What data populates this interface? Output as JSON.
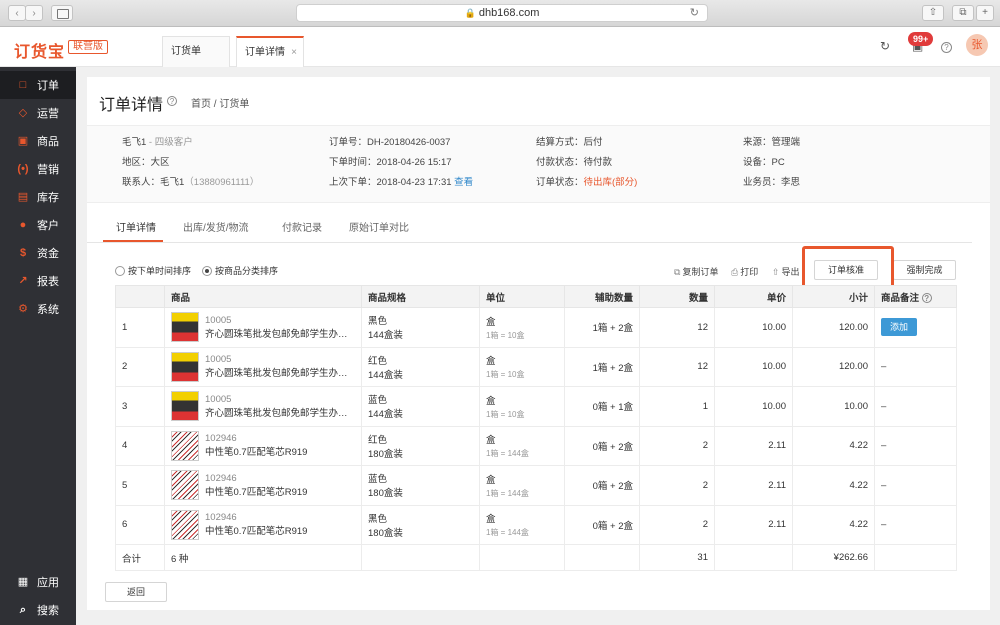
{
  "browser": {
    "url": "dhb168.com"
  },
  "app": {
    "logo": "订货宝",
    "edition": "联营版",
    "tabs": [
      {
        "label": "订货单",
        "close": ""
      },
      {
        "label": "订单详情",
        "close": "×"
      }
    ],
    "notif_badge": "99+",
    "help_icon": "?",
    "avatar_text": "张"
  },
  "sidebar": {
    "items": [
      {
        "label": "订单",
        "icon": "order-icon",
        "glyph": "□"
      },
      {
        "label": "运营",
        "icon": "operation-icon",
        "glyph": "◇"
      },
      {
        "label": "商品",
        "icon": "goods-icon",
        "glyph": "▣"
      },
      {
        "label": "营销",
        "icon": "marketing-icon",
        "glyph": "(•)"
      },
      {
        "label": "库存",
        "icon": "stock-icon",
        "glyph": "▤"
      },
      {
        "label": "客户",
        "icon": "customer-icon",
        "glyph": "●"
      },
      {
        "label": "资金",
        "icon": "fund-icon",
        "glyph": "$"
      },
      {
        "label": "报表",
        "icon": "report-icon",
        "glyph": "↗"
      },
      {
        "label": "系统",
        "icon": "system-icon",
        "glyph": "⚙"
      }
    ],
    "bottom": [
      {
        "label": "应用",
        "icon": "apps-icon",
        "glyph": "▦"
      },
      {
        "label": "搜索",
        "icon": "search-icon",
        "glyph": "⌕"
      }
    ]
  },
  "page": {
    "title": "订单详情",
    "breadcrumb": "首页 / 订货单",
    "info": {
      "customer": "毛飞1",
      "customer_level": " - 四级客户",
      "region": "地区：大区",
      "contact": "联系人：毛飞1",
      "contact_phone": "（13880961111）",
      "order_no": "订单号：DH-20180426-0037",
      "order_time": "下单时间：2018-04-26 15:17",
      "last_order": "上次下单：2018-04-23 17:31",
      "view_link": "查看",
      "settle": "结算方式：后付",
      "pay_status": "付款状态：待付款",
      "order_status_label": "订单状态：",
      "order_status_value": "待出库(部分)",
      "source": "来源：管理端",
      "device": "设备：PC",
      "salesman": "业务员：李思"
    },
    "tabs": [
      "订单详情",
      "出库/发货/物流",
      "付款记录",
      "原始订单对比"
    ],
    "sort_options": [
      "按下单时间排序",
      "按商品分类排序"
    ],
    "tools": {
      "copy": "复制订单",
      "print": "打印",
      "export": "导出"
    },
    "buttons": {
      "approve": "订单核准",
      "force_complete": "强制完成",
      "back": "返回"
    }
  },
  "table": {
    "headers": [
      "商品",
      "商品规格",
      "单位",
      "辅助数量",
      "数量",
      "单价",
      "小计",
      "商品备注"
    ],
    "rows": [
      {
        "idx": "1",
        "code": "10005",
        "name": "齐心圆珠笔批发包邮免邮学生办公…",
        "spec_color": "黑色",
        "spec_pack": "144盒装",
        "unit": "盒",
        "unit_conv": "1箱 = 10盒",
        "aux": "1箱 + 2盒",
        "qty": "12",
        "price": "10.00",
        "subtotal": "120.00",
        "remark": "添加",
        "thumb": "t1"
      },
      {
        "idx": "2",
        "code": "10005",
        "name": "齐心圆珠笔批发包邮免邮学生办公…",
        "spec_color": "红色",
        "spec_pack": "144盒装",
        "unit": "盒",
        "unit_conv": "1箱 = 10盒",
        "aux": "1箱 + 2盒",
        "qty": "12",
        "price": "10.00",
        "subtotal": "120.00",
        "remark": "–",
        "thumb": "t1"
      },
      {
        "idx": "3",
        "code": "10005",
        "name": "齐心圆珠笔批发包邮免邮学生办公…",
        "spec_color": "蓝色",
        "spec_pack": "144盒装",
        "unit": "盒",
        "unit_conv": "1箱 = 10盒",
        "aux": "0箱 + 1盒",
        "qty": "1",
        "price": "10.00",
        "subtotal": "10.00",
        "remark": "–",
        "thumb": "t1"
      },
      {
        "idx": "4",
        "code": "102946",
        "name": "中性笔0.7匹配笔芯R919",
        "spec_color": "红色",
        "spec_pack": "180盒装",
        "unit": "盒",
        "unit_conv": "1箱 = 144盒",
        "aux": "0箱 + 2盒",
        "qty": "2",
        "price": "2.11",
        "subtotal": "4.22",
        "remark": "–",
        "thumb": "t2"
      },
      {
        "idx": "5",
        "code": "102946",
        "name": "中性笔0.7匹配笔芯R919",
        "spec_color": "蓝色",
        "spec_pack": "180盒装",
        "unit": "盒",
        "unit_conv": "1箱 = 144盒",
        "aux": "0箱 + 2盒",
        "qty": "2",
        "price": "2.11",
        "subtotal": "4.22",
        "remark": "–",
        "thumb": "t2"
      },
      {
        "idx": "6",
        "code": "102946",
        "name": "中性笔0.7匹配笔芯R919",
        "spec_color": "黑色",
        "spec_pack": "180盒装",
        "unit": "盒",
        "unit_conv": "1箱 = 144盒",
        "aux": "0箱 + 2盒",
        "qty": "2",
        "price": "2.11",
        "subtotal": "4.22",
        "remark": "–",
        "thumb": "t2"
      }
    ],
    "total": {
      "label": "合计",
      "kinds": "6 种",
      "qty": "31",
      "amount": "¥262.66"
    }
  },
  "colors": {
    "brand": "#e8572d",
    "sidebar_bg": "#2f3035",
    "link": "#2d86c9",
    "add_button": "#3d99d6"
  }
}
